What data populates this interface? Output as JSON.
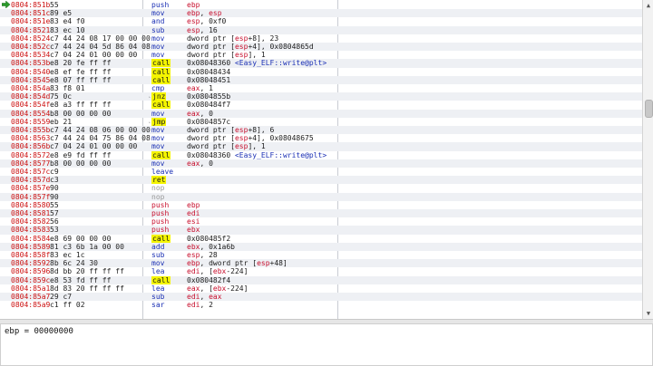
{
  "colors": {
    "address": "#cc1111",
    "mnemonic": "#1a2fb4",
    "register": "#c8102e",
    "highlight": "#f5f500",
    "alt_row": "#eef0f4"
  },
  "icons": {
    "current_ip": "green-arrow-icon"
  },
  "info": {
    "text": "ebp = 00000000"
  },
  "rows": [
    {
      "addr": "0804:851b",
      "bytes": "55",
      "parts": [
        [
          "m",
          "push"
        ],
        [
          "r",
          "ebp"
        ]
      ]
    },
    {
      "addr": "0804:851c",
      "bytes": "89 e5",
      "parts": [
        [
          "m",
          "mov"
        ],
        [
          "r",
          "ebp"
        ],
        [
          "t",
          ", "
        ],
        [
          "r",
          "esp"
        ]
      ]
    },
    {
      "addr": "0804:851e",
      "bytes": "83 e4 f0",
      "parts": [
        [
          "m",
          "and"
        ],
        [
          "r",
          "esp"
        ],
        [
          "t",
          ", 0xf0"
        ]
      ]
    },
    {
      "addr": "0804:8521",
      "bytes": "83 ec 10",
      "parts": [
        [
          "m",
          "sub"
        ],
        [
          "r",
          "esp"
        ],
        [
          "t",
          ", 16"
        ]
      ]
    },
    {
      "addr": "0804:8524",
      "bytes": "c7 44 24 08 17 00 00 00",
      "parts": [
        [
          "m",
          "mov"
        ],
        [
          "t",
          "dword ptr ["
        ],
        [
          "r",
          "esp"
        ],
        [
          "t",
          "+8], 23"
        ]
      ]
    },
    {
      "addr": "0804:852c",
      "bytes": "c7 44 24 04 5d 86 04 08",
      "parts": [
        [
          "m",
          "mov"
        ],
        [
          "t",
          "dword ptr ["
        ],
        [
          "r",
          "esp"
        ],
        [
          "t",
          "+4], 0x0804865d"
        ]
      ]
    },
    {
      "addr": "0804:8534",
      "bytes": "c7 04 24 01 00 00 00",
      "parts": [
        [
          "m",
          "mov"
        ],
        [
          "t",
          "dword ptr ["
        ],
        [
          "r",
          "esp"
        ],
        [
          "t",
          "], 1"
        ]
      ]
    },
    {
      "addr": "0804:853b",
      "bytes": "e8 20 fe ff ff",
      "parts": [
        [
          "c",
          "call"
        ],
        [
          "t",
          "0x08048360 "
        ],
        [
          "s",
          "<Easy_ELF::write@plt>"
        ]
      ]
    },
    {
      "addr": "0804:8540",
      "bytes": "e8 ef fe ff ff",
      "parts": [
        [
          "c",
          "call"
        ],
        [
          "t",
          "0x08048434"
        ]
      ]
    },
    {
      "addr": "0804:8545",
      "bytes": "e8 07 ff ff ff",
      "parts": [
        [
          "c",
          "call"
        ],
        [
          "t",
          "0x08048451"
        ]
      ]
    },
    {
      "addr": "0804:854a",
      "bytes": "83 f8 01",
      "parts": [
        [
          "m",
          "cmp"
        ],
        [
          "r",
          "eax"
        ],
        [
          "t",
          ", 1"
        ]
      ]
    },
    {
      "addr": "0804:854d",
      "bytes": "75 0c",
      "jm": "ˎ",
      "parts": [
        [
          "c",
          "jnz"
        ],
        [
          "t",
          "0x0804855b"
        ]
      ]
    },
    {
      "addr": "0804:854f",
      "bytes": "e8 a3 ff ff ff",
      "parts": [
        [
          "c",
          "call"
        ],
        [
          "t",
          "0x080484f7"
        ]
      ]
    },
    {
      "addr": "0804:8554",
      "bytes": "b8 00 00 00 00",
      "parts": [
        [
          "m",
          "mov"
        ],
        [
          "r",
          "eax"
        ],
        [
          "t",
          ", 0"
        ]
      ]
    },
    {
      "addr": "0804:8559",
      "bytes": "eb 21",
      "jm": "ˎ",
      "parts": [
        [
          "c",
          "jmp"
        ],
        [
          "t",
          "0x0804857c"
        ]
      ]
    },
    {
      "addr": "0804:855b",
      "bytes": "c7 44 24 08 06 00 00 00",
      "parts": [
        [
          "m",
          "mov"
        ],
        [
          "t",
          "dword ptr ["
        ],
        [
          "r",
          "esp"
        ],
        [
          "t",
          "+8], 6"
        ]
      ]
    },
    {
      "addr": "0804:8563",
      "bytes": "c7 44 24 04 75 86 04 08",
      "parts": [
        [
          "m",
          "mov"
        ],
        [
          "t",
          "dword ptr ["
        ],
        [
          "r",
          "esp"
        ],
        [
          "t",
          "+4], 0x08048675"
        ]
      ]
    },
    {
      "addr": "0804:856b",
      "bytes": "c7 04 24 01 00 00 00",
      "parts": [
        [
          "m",
          "mov"
        ],
        [
          "t",
          "dword ptr ["
        ],
        [
          "r",
          "esp"
        ],
        [
          "t",
          "], 1"
        ]
      ]
    },
    {
      "addr": "0804:8572",
      "bytes": "e8 e9 fd ff ff",
      "parts": [
        [
          "c",
          "call"
        ],
        [
          "t",
          "0x08048360 "
        ],
        [
          "s",
          "<Easy_ELF::write@plt>"
        ]
      ]
    },
    {
      "addr": "0804:8577",
      "bytes": "b8 00 00 00 00",
      "parts": [
        [
          "m",
          "mov"
        ],
        [
          "r",
          "eax"
        ],
        [
          "t",
          ", 0"
        ]
      ]
    },
    {
      "addr": "0804:857c",
      "bytes": "c9",
      "parts": [
        [
          "m",
          "leave"
        ]
      ]
    },
    {
      "addr": "0804:857d",
      "bytes": "c3",
      "parts": [
        [
          "c",
          "ret"
        ]
      ]
    },
    {
      "addr": "0804:857e",
      "bytes": "90",
      "parts": [
        [
          "n",
          "nop"
        ]
      ]
    },
    {
      "addr": "0804:857f",
      "bytes": "90",
      "parts": [
        [
          "n",
          "nop"
        ]
      ]
    },
    {
      "addr": "0804:8580",
      "bytes": "55",
      "parts": [
        [
          "p",
          "push"
        ],
        [
          "r",
          "ebp"
        ]
      ]
    },
    {
      "addr": "0804:8581",
      "bytes": "57",
      "parts": [
        [
          "p",
          "push"
        ],
        [
          "r",
          "edi"
        ]
      ]
    },
    {
      "addr": "0804:8582",
      "bytes": "56",
      "parts": [
        [
          "p",
          "push"
        ],
        [
          "r",
          "esi"
        ]
      ]
    },
    {
      "addr": "0804:8583",
      "bytes": "53",
      "parts": [
        [
          "p",
          "push"
        ],
        [
          "r",
          "ebx"
        ]
      ]
    },
    {
      "addr": "0804:8584",
      "bytes": "e8 69 00 00 00",
      "parts": [
        [
          "c",
          "call"
        ],
        [
          "t",
          "0x080485f2"
        ]
      ]
    },
    {
      "addr": "0804:8589",
      "bytes": "81 c3 6b 1a 00 00",
      "parts": [
        [
          "m",
          "add"
        ],
        [
          "r",
          "ebx"
        ],
        [
          "t",
          ", 0x1a6b"
        ]
      ]
    },
    {
      "addr": "0804:858f",
      "bytes": "83 ec 1c",
      "parts": [
        [
          "m",
          "sub"
        ],
        [
          "r",
          "esp"
        ],
        [
          "t",
          ", 28"
        ]
      ]
    },
    {
      "addr": "0804:8592",
      "bytes": "8b 6c 24 30",
      "parts": [
        [
          "m",
          "mov"
        ],
        [
          "r",
          "ebp"
        ],
        [
          "t",
          ", dword ptr ["
        ],
        [
          "r",
          "esp"
        ],
        [
          "t",
          "+48]"
        ]
      ]
    },
    {
      "addr": "0804:8596",
      "bytes": "8d bb 20 ff ff ff",
      "parts": [
        [
          "m",
          "lea"
        ],
        [
          "r",
          "edi"
        ],
        [
          "t",
          ", ["
        ],
        [
          "r",
          "ebx"
        ],
        [
          "t",
          "-224]"
        ]
      ]
    },
    {
      "addr": "0804:859c",
      "bytes": "e8 53 fd ff ff",
      "parts": [
        [
          "c",
          "call"
        ],
        [
          "t",
          "0x080482f4"
        ]
      ]
    },
    {
      "addr": "0804:85a1",
      "bytes": "8d 83 20 ff ff ff",
      "parts": [
        [
          "m",
          "lea"
        ],
        [
          "r",
          "eax"
        ],
        [
          "t",
          ", ["
        ],
        [
          "r",
          "ebx"
        ],
        [
          "t",
          "-224]"
        ]
      ]
    },
    {
      "addr": "0804:85a7",
      "bytes": "29 c7",
      "parts": [
        [
          "m",
          "sub"
        ],
        [
          "r",
          "edi"
        ],
        [
          "t",
          ", "
        ],
        [
          "r",
          "eax"
        ]
      ]
    },
    {
      "addr": "0804:85a9",
      "bytes": "c1 ff 02",
      "parts": [
        [
          "m",
          "sar"
        ],
        [
          "r",
          "edi"
        ],
        [
          "t",
          ", 2"
        ]
      ]
    }
  ]
}
